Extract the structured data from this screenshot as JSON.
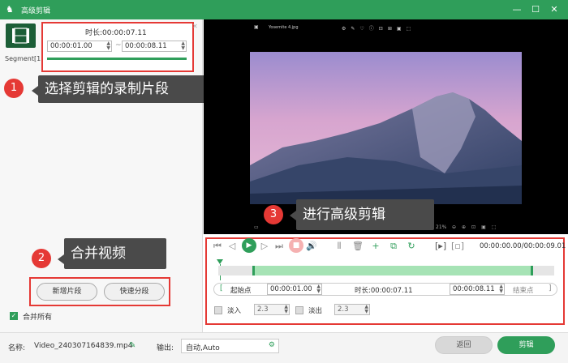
{
  "window": {
    "title": "高级剪辑",
    "logo_icon": "rabbit-logo-icon",
    "minimize_icon": "minimize-icon",
    "maximize_icon": "maximize-icon",
    "close_icon": "close-icon"
  },
  "segment": {
    "label": "Segment[1]",
    "duration_label": "时长:",
    "duration": "00:00:07.11",
    "start": "00:00:01.00",
    "end": "00:00:08.11",
    "separator": "~",
    "close_icon": "close-icon"
  },
  "callouts": [
    {
      "num": "1",
      "text": "选择剪辑的录制片段"
    },
    {
      "num": "2",
      "text": "合并视频"
    },
    {
      "num": "3",
      "text": "进行高级剪辑"
    }
  ],
  "buttons": {
    "add_segment": "新增片段",
    "quick_split": "快速分段",
    "merge_all": "合并所有",
    "back": "返回",
    "edit": "剪辑"
  },
  "player": {
    "filename": "Yosemite 4.jpg",
    "zoom": "21%",
    "time_current": "00:00:00.00",
    "time_total": "00:00:09.01"
  },
  "trim": {
    "start_label": "起始点",
    "start_value": "00:00:01.00",
    "duration_label": "时长:",
    "duration_value": "00:00:07.11",
    "end_value": "00:00:08.11",
    "end_label": "结束点"
  },
  "fade": {
    "fade_in_label": "淡入",
    "fade_in_value": "2.3",
    "fade_out_label": "淡出",
    "fade_out_value": "2.3"
  },
  "footer": {
    "name_label": "名称:",
    "name_value": "Video_240307164839.mp4",
    "output_label": "输出:",
    "output_value": "自动,Auto"
  },
  "colors": {
    "accent": "#2f9e5a",
    "highlight": "#e53935"
  }
}
